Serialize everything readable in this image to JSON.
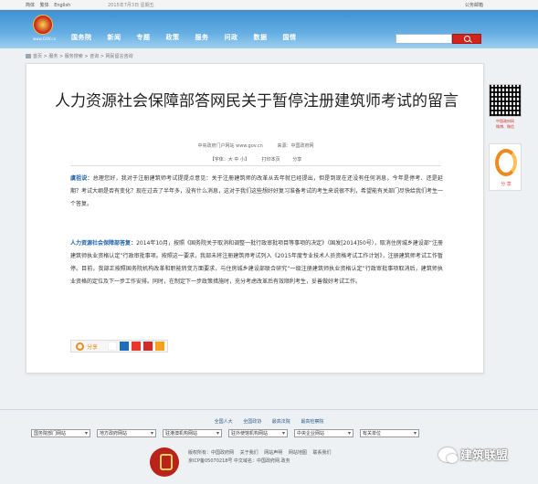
{
  "topbar": {
    "lang_simplified": "简体",
    "lang_traditional": "繁体",
    "lang_english": "English",
    "date": "2015年7月3日 星期五",
    "mail": "公务邮箱"
  },
  "header": {
    "logo_text": "www.GOV.cn",
    "nav": [
      "国务院",
      "新闻",
      "专题",
      "政策",
      "服务",
      "问政",
      "数据",
      "国情"
    ],
    "search_placeholder": ""
  },
  "breadcrumb": "首页 > 服务 > 服务搜索 > 咨询 > 网民留言咨询",
  "article": {
    "title": "人力资源社会保障部答网民关于暂停注册建筑师考试的留言",
    "source_site": "中央政府门户网站 www.gov.cn",
    "source": "来源：中国政府网",
    "font_size": "【字体：大 中 小】",
    "print": "打印本页",
    "share": "分享",
    "p1_lead": "虞祖说：",
    "p1_body": "总理您好，我对于注册建筑师考试提提点意见：关于注册建筑师的改革从去年就已经提出，但是到现在还没有任何消息，今年是停考、还是延期？考试大纲是否有变化？现在过去了半年多，没有什么消息，这对于我们这些想好好复习准备考试的考生来说很不利，希望能有关部门尽快给我们考生一个答复。",
    "p2_lead": "人力资源社会保障部答复：",
    "p2_body": "2014年10月，按照《国务院关于取消和调整一批行政审批项目等事项的决定》（国发[2014]50号），取消住房城乡建设部“注册建筑师执业资格认定”行政审批事项。按照这一要求，我部未将注册建筑师考试列入《2015年度专业技术人员资格考试工作计划》，注册建筑师考试工作暂停。目前，我部正按照国务院机构改革和职能转变方面要求，与住房城乡建设部联合研究“一级注册建筑师执业资格认定”行政审批事项取消后，建筑师执业资格的定位及下一步工作安排。同时，在制定下一步政策措施时，充分考虑改革后有效顺利考生，妥善做好考试工作。",
    "share_label": "分享"
  },
  "sidebar": {
    "qr_caption": "中国政府网\n微博、微信",
    "share_label": "分 享"
  },
  "footer": {
    "links": [
      "全国人大",
      "全国政协",
      "最高法院",
      "最高检察院"
    ],
    "selects": [
      "国务院部门网站",
      "地方政府网站",
      "驻港澳机构网站",
      "驻外使馆机构网站",
      "中央企业网站",
      "有关单位"
    ],
    "line1": [
      "版权所有：中国政府网",
      "关于我们",
      "网站声明",
      "网站地图",
      "联系我们"
    ],
    "line2": "京ICP备05070218号  中文域名：中国政府网.政务"
  },
  "watermark": {
    "text": "建筑联盟"
  },
  "colors": {
    "header_blue": "#3f8fd0",
    "search_red": "#d1251c",
    "link_blue": "#2063a8",
    "share_orange": "#f08a1c"
  }
}
